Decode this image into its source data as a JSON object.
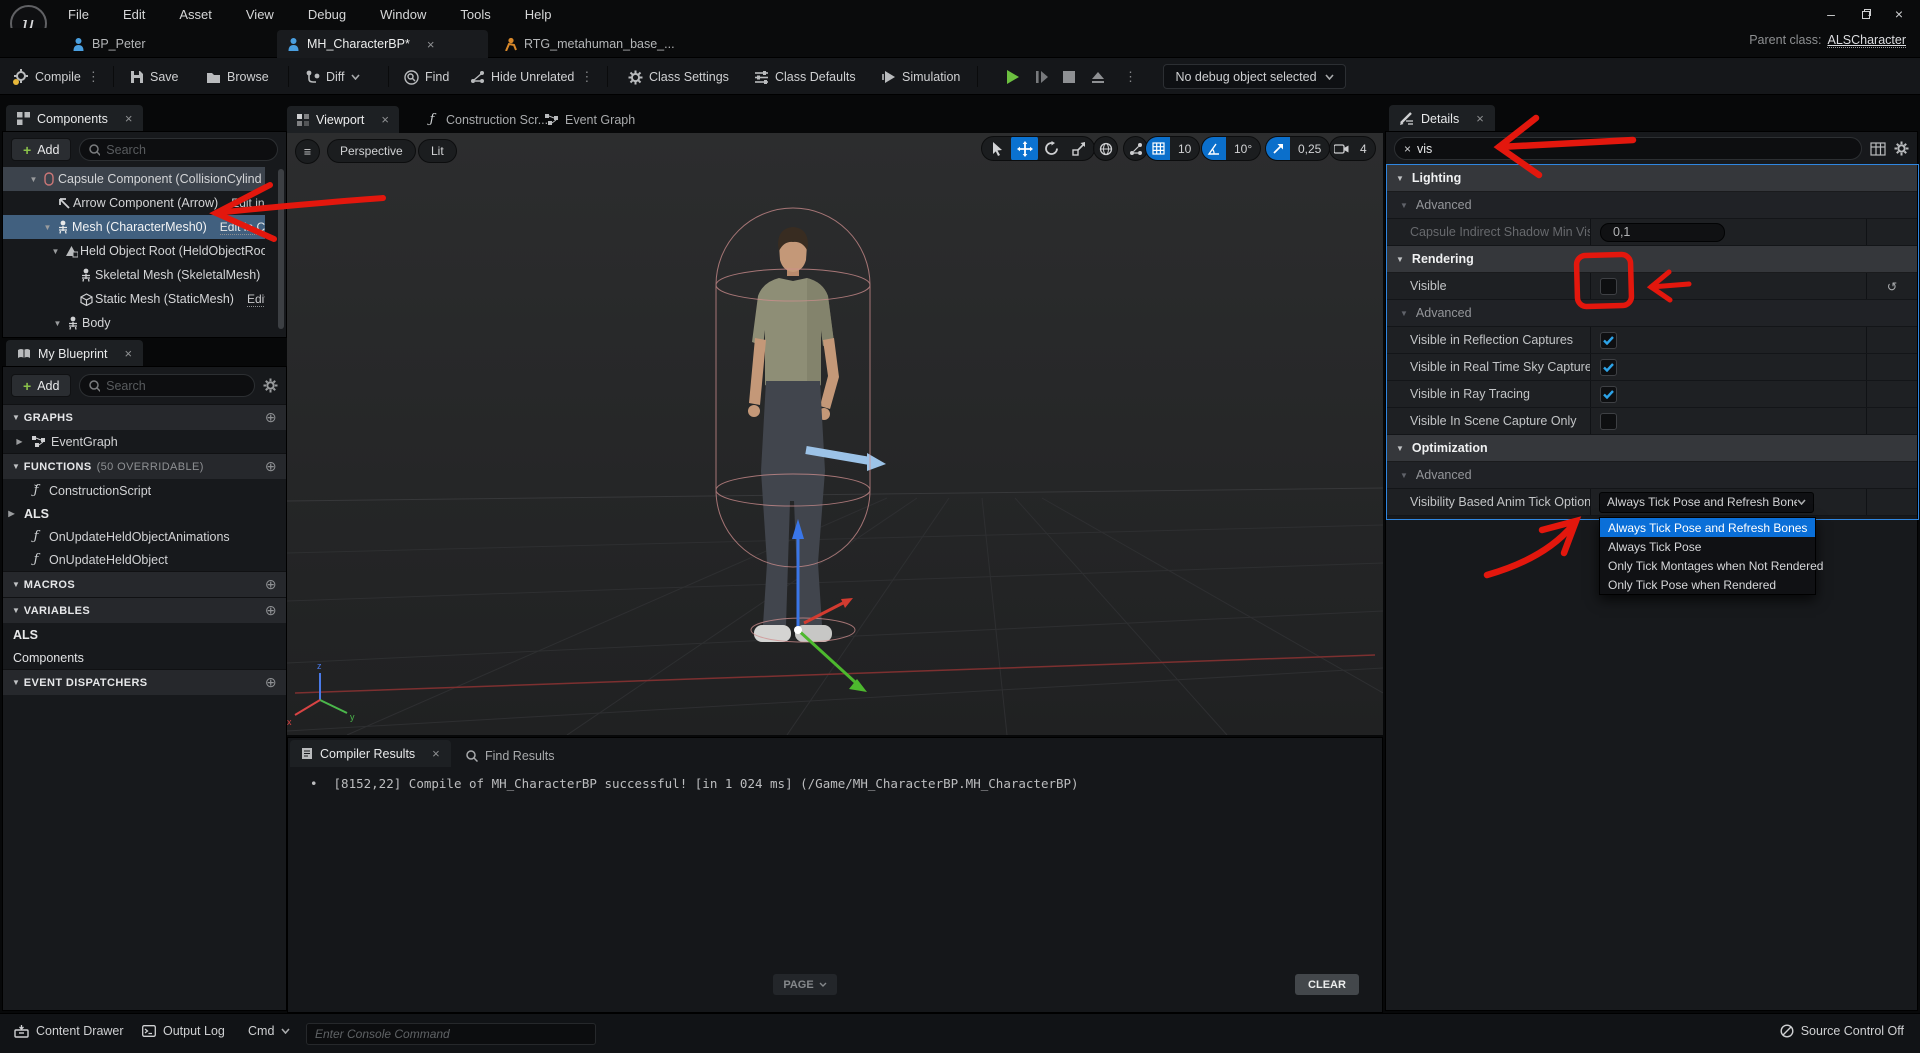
{
  "window": {
    "menu": [
      "File",
      "Edit",
      "Asset",
      "View",
      "Debug",
      "Window",
      "Tools",
      "Help"
    ],
    "tabs": [
      {
        "label": "BP_Peter"
      },
      {
        "label": "MH_CharacterBP*"
      },
      {
        "label": "RTG_metahuman_base_..."
      }
    ],
    "parent_class_label": "Parent class:",
    "parent_class_value": "ALSCharacter"
  },
  "toolbar": {
    "compile": "Compile",
    "save": "Save",
    "browse": "Browse",
    "diff": "Diff",
    "find": "Find",
    "hide_unrelated": "Hide Unrelated",
    "class_settings": "Class Settings",
    "class_defaults": "Class Defaults",
    "simulation": "Simulation",
    "debug_object": "No debug object selected"
  },
  "components": {
    "title": "Components",
    "add": "Add",
    "search_placeholder": "Search",
    "tree": [
      {
        "label": "Capsule Component (CollisionCylind"
      },
      {
        "label": "Arrow Component (Arrow)",
        "edit": "Edit in"
      },
      {
        "label": "Mesh (CharacterMesh0)",
        "edit": "Edit in C"
      },
      {
        "label": "Held Object Root (HeldObjectRoo"
      },
      {
        "label": "Skeletal Mesh (SkeletalMesh)"
      },
      {
        "label": "Static Mesh (StaticMesh)",
        "edit": "Edit"
      },
      {
        "label": "Body"
      }
    ]
  },
  "my_blueprint": {
    "title": "My Blueprint",
    "add": "Add",
    "search_placeholder": "Search",
    "graphs_header": "GRAPHS",
    "event_graph": "EventGraph",
    "functions_header": "FUNCTIONS",
    "functions_note": "(50 OVERRIDABLE)",
    "construction_script": "ConstructionScript",
    "als_group": "ALS",
    "fn1": "OnUpdateHeldObjectAnimations",
    "fn2": "OnUpdateHeldObject",
    "macros_header": "MACROS",
    "variables_header": "VARIABLES",
    "var_group1": "ALS",
    "var_group2": "Components",
    "dispatchers_header": "EVENT DISPATCHERS"
  },
  "viewport": {
    "tab": "Viewport",
    "tab2": "Construction Scr...",
    "tab3": "Event Graph",
    "perspective": "Perspective",
    "lit": "Lit",
    "grid_snap": "10",
    "angle_snap": "10°",
    "scale_snap": "0,25",
    "camera_speed": "4"
  },
  "compiler": {
    "tab": "Compiler Results",
    "tab2": "Find Results",
    "bullet": "•",
    "message": "[8152,22] Compile of MH_CharacterBP successful! [in 1 024 ms] (/Game/MH_CharacterBP.MH_CharacterBP)",
    "page": "PAGE",
    "clear": "CLEAR"
  },
  "details": {
    "title": "Details",
    "search_value": "vis",
    "lighting": "Lighting",
    "advanced": "Advanced",
    "capsule_label": "Capsule Indirect Shadow Min Visibi...",
    "capsule_value": "0,1",
    "rendering": "Rendering",
    "visible": "Visible",
    "refl": "Visible in Reflection Captures",
    "sky": "Visible in Real Time Sky Captures",
    "ray": "Visible in Ray Tracing",
    "scene": "Visible In Scene Capture Only",
    "optimization": "Optimization",
    "tick_label": "Visibility Based Anim Tick Option",
    "tick_value": "Always Tick Pose and Refresh Bones",
    "options": [
      "Always Tick Pose and Refresh Bones",
      "Always Tick Pose",
      "Only Tick Montages when Not Rendered",
      "Only Tick Pose when Rendered"
    ]
  },
  "status": {
    "content_drawer": "Content Drawer",
    "output_log": "Output Log",
    "cmd": "Cmd",
    "console_placeholder": "Enter Console Command",
    "source_control": "Source Control Off"
  },
  "colors": {
    "accent_blue": "#0a6fd8",
    "selection_blue": "#41607f",
    "annotation_red": "#e3170d",
    "check_blue": "#2da3e8",
    "move_tool_blue": "#0b72d0"
  }
}
